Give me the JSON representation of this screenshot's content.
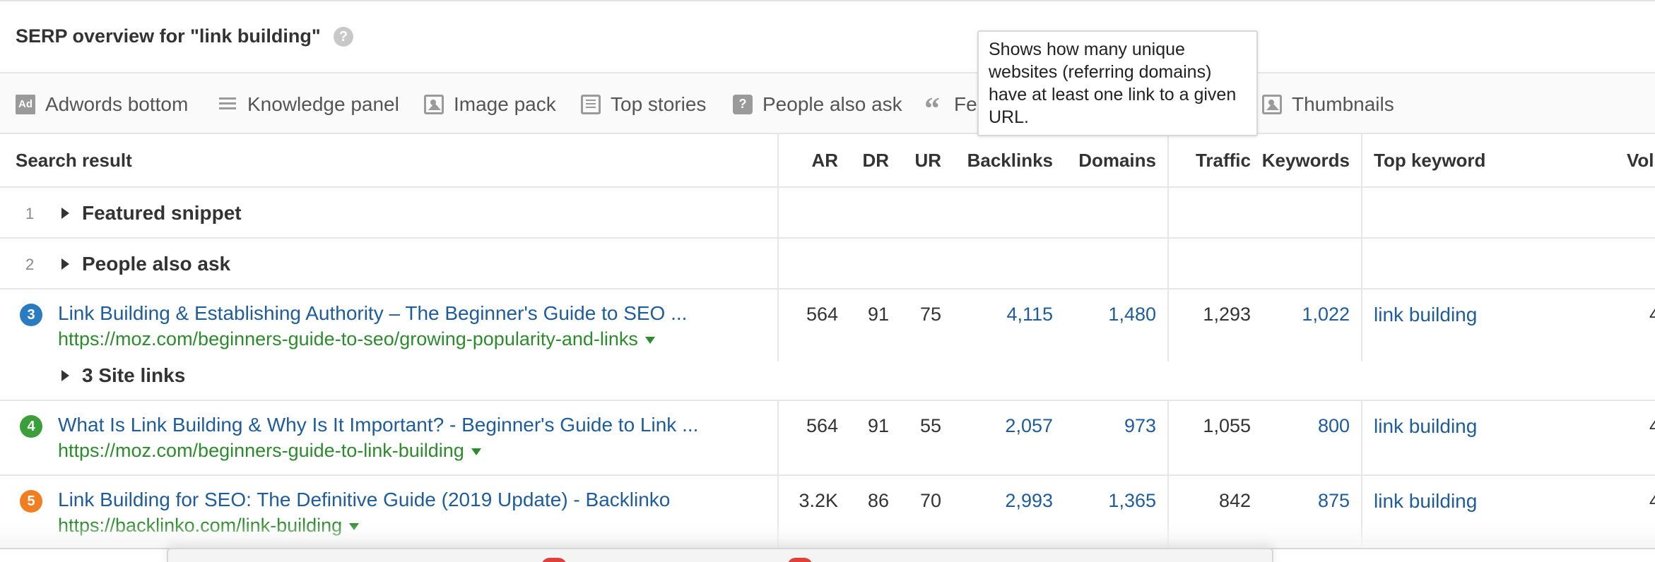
{
  "header": {
    "title": "SERP overview for \"link building\"",
    "help_icon": "question-icon"
  },
  "features": [
    {
      "label": "Adwords bottom",
      "icon": "ad-icon"
    },
    {
      "label": "Knowledge panel",
      "icon": "knowledge-panel-icon"
    },
    {
      "label": "Image pack",
      "icon": "image-icon"
    },
    {
      "label": "Top stories",
      "icon": "news-icon"
    },
    {
      "label": "People also ask",
      "icon": "question-box-icon"
    },
    {
      "label": "Fe",
      "icon": "quote-icon"
    },
    {
      "label": "Thumbnails",
      "icon": "image-icon"
    }
  ],
  "tooltip": {
    "text": "Shows how many unique websites (referring domains) have at least one link to a given URL."
  },
  "table": {
    "columns": {
      "search_result": "Search result",
      "ar": "AR",
      "dr": "DR",
      "ur": "UR",
      "backlinks": "Backlinks",
      "domains": "Domains",
      "traffic": "Traffic",
      "keywords": "Keywords",
      "top_keyword": "Top keyword",
      "volume": "Vol"
    },
    "groups": [
      {
        "num": "1",
        "label": "Featured snippet"
      },
      {
        "num": "2",
        "label": "People also ask"
      }
    ],
    "results": [
      {
        "pos": "3",
        "color": "#2a7bbf",
        "title": "Link Building & Establishing Authority – The Beginner's Guide to SEO ...",
        "url": "https://moz.com/beginners-guide-to-seo/growing-popularity-and-links",
        "ar": "564",
        "dr": "91",
        "ur": "75",
        "backlinks": "4,115",
        "domains": "1,480",
        "traffic": "1,293",
        "keywords": "1,022",
        "top_keyword": "link building",
        "volume": "4",
        "sitelinks": "3 Site links"
      },
      {
        "pos": "4",
        "color": "#3a9e3a",
        "title": "What Is Link Building & Why Is It Important? - Beginner's Guide to Link ...",
        "url": "https://moz.com/beginners-guide-to-link-building",
        "ar": "564",
        "dr": "91",
        "ur": "55",
        "backlinks": "2,057",
        "domains": "973",
        "traffic": "1,055",
        "keywords": "800",
        "top_keyword": "link building",
        "volume": "4"
      },
      {
        "pos": "5",
        "color": "#f07f22",
        "title": "Link Building for SEO: The Definitive Guide (2019 Update) - Backlinko",
        "url": "https://backlinko.com/link-building",
        "ar": "3.2K",
        "dr": "86",
        "ur": "70",
        "backlinks": "2,993",
        "domains": "1,365",
        "traffic": "842",
        "keywords": "875",
        "top_keyword": "link building",
        "volume": "4"
      }
    ]
  }
}
